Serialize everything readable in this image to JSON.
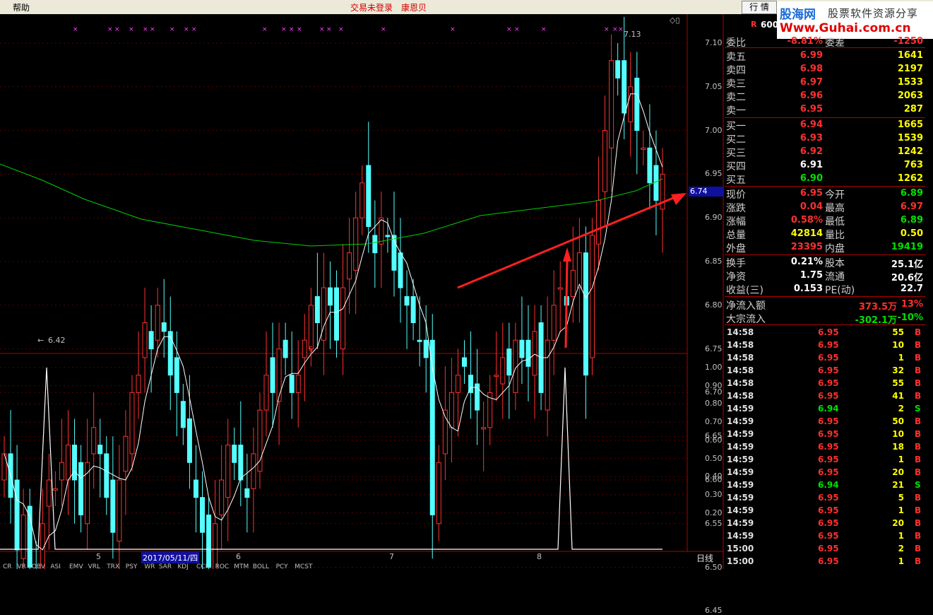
{
  "topbar": {
    "menu_help": "帮助",
    "trade_status": "交易未登录",
    "user_name": "康恩贝",
    "quote_button": "行 情"
  },
  "logo": {
    "brand": "股海网",
    "slogan": "股票软件资源分享",
    "url": "Www.Guhai.com.cn"
  },
  "stock_code_fragment": "600",
  "stock_code_prefix": "R",
  "chart": {
    "price_ticks": [
      "7.10",
      "7.05",
      "7.00",
      "6.95",
      "6.90",
      "6.85",
      "6.80",
      "6.75",
      "6.70",
      "6.65",
      "6.60",
      "6.55",
      "6.50",
      "6.45"
    ],
    "current_price_box": "6.74",
    "high_label": "7.13",
    "low_label": "6.42",
    "indicator_ticks": [
      "1.00",
      "0.90",
      "0.80",
      "0.70",
      "0.60",
      "0.50",
      "0.40",
      "0.30",
      "0.20"
    ],
    "date_ticks": [
      "5",
      "2017/05/11/四",
      "6",
      "7",
      "8"
    ],
    "period_label": "日线",
    "section_mark": "§"
  },
  "quote": {
    "weibi": {
      "label": "委比",
      "value": "-8.81%",
      "label2": "委差",
      "value2": "-1250"
    },
    "sells": [
      {
        "label": "卖五",
        "price": "6.99",
        "vol": "1641"
      },
      {
        "label": "卖四",
        "price": "6.98",
        "vol": "2197"
      },
      {
        "label": "卖三",
        "price": "6.97",
        "vol": "1533"
      },
      {
        "label": "卖二",
        "price": "6.96",
        "vol": "2063"
      },
      {
        "label": "卖一",
        "price": "6.95",
        "vol": "287"
      }
    ],
    "buys": [
      {
        "label": "买一",
        "price": "6.94",
        "vol": "1665"
      },
      {
        "label": "买二",
        "price": "6.93",
        "vol": "1539"
      },
      {
        "label": "买三",
        "price": "6.92",
        "vol": "1242"
      },
      {
        "label": "买四",
        "price": "6.91",
        "vol": "763"
      },
      {
        "label": "买五",
        "price": "6.90",
        "vol": "1262"
      }
    ],
    "stats": [
      {
        "l1": "现价",
        "v1": "6.95",
        "l2": "今开",
        "v2": "6.89"
      },
      {
        "l1": "涨跌",
        "v1": "0.04",
        "l2": "最高",
        "v2": "6.97"
      },
      {
        "l1": "涨幅",
        "v1": "0.58%",
        "l2": "最低",
        "v2": "6.89"
      },
      {
        "l1": "总量",
        "v1": "42814",
        "l2": "量比",
        "v2": "0.50"
      },
      {
        "l1": "外盘",
        "v1": "23395",
        "l2": "内盘",
        "v2": "19419"
      }
    ],
    "fund": [
      {
        "l1": "换手",
        "v1": "0.21%",
        "l2": "股本",
        "v2": "25.1亿"
      },
      {
        "l1": "净资",
        "v1": "1.75",
        "l2": "流通",
        "v2": "20.6亿"
      },
      {
        "l1": "收益(三)",
        "v1": "0.153",
        "l2": "PE(动)",
        "v2": "22.7"
      }
    ],
    "flow": [
      {
        "label": "净流入额",
        "amount": "373.5万",
        "pct": "13%"
      },
      {
        "label": "大宗流入",
        "amount": "-302.1万",
        "pct": "-10%"
      }
    ]
  },
  "trades": [
    {
      "t": "14:58",
      "p": "6.95",
      "v": "55",
      "d": "B"
    },
    {
      "t": "14:58",
      "p": "6.95",
      "v": "10",
      "d": "B"
    },
    {
      "t": "14:58",
      "p": "6.95",
      "v": "1",
      "d": "B"
    },
    {
      "t": "14:58",
      "p": "6.95",
      "v": "32",
      "d": "B"
    },
    {
      "t": "14:58",
      "p": "6.95",
      "v": "55",
      "d": "B"
    },
    {
      "t": "14:58",
      "p": "6.95",
      "v": "41",
      "d": "B"
    },
    {
      "t": "14:59",
      "p": "6.94",
      "v": "2",
      "d": "S"
    },
    {
      "t": "14:59",
      "p": "6.95",
      "v": "50",
      "d": "B"
    },
    {
      "t": "14:59",
      "p": "6.95",
      "v": "10",
      "d": "B"
    },
    {
      "t": "14:59",
      "p": "6.95",
      "v": "18",
      "d": "B"
    },
    {
      "t": "14:59",
      "p": "6.95",
      "v": "1",
      "d": "B"
    },
    {
      "t": "14:59",
      "p": "6.95",
      "v": "20",
      "d": "B"
    },
    {
      "t": "14:59",
      "p": "6.94",
      "v": "21",
      "d": "S"
    },
    {
      "t": "14:59",
      "p": "6.95",
      "v": "5",
      "d": "B"
    },
    {
      "t": "14:59",
      "p": "6.95",
      "v": "1",
      "d": "B"
    },
    {
      "t": "14:59",
      "p": "6.95",
      "v": "20",
      "d": "B"
    },
    {
      "t": "14:59",
      "p": "6.95",
      "v": "1",
      "d": "B"
    },
    {
      "t": "15:00",
      "p": "6.95",
      "v": "2",
      "d": "B"
    },
    {
      "t": "15:00",
      "p": "6.95",
      "v": "1",
      "d": "B"
    }
  ],
  "bottom_tabs": [
    "CR",
    "VR",
    "OBV",
    "ASI",
    "EMV",
    "VRL",
    "TRX",
    "PSY",
    "WR",
    "SAR",
    "KDJ",
    "CCI",
    "ROC",
    "MTM",
    "BOLL",
    "PCY",
    "MCST"
  ],
  "colors": {
    "up": "#ff3030",
    "down": "#54ffff",
    "ma_short": "#ffffff",
    "ma_long": "#00d000",
    "arrow": "#ff2020",
    "grid": "#5a0000"
  }
}
